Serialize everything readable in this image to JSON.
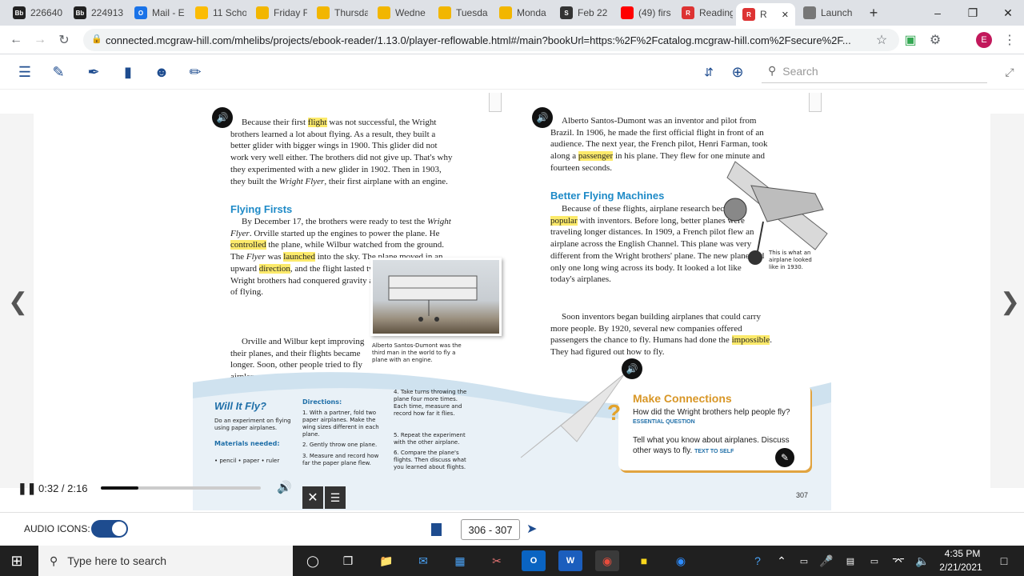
{
  "browser": {
    "tabs": [
      {
        "label": "226640",
        "icon": "Bb",
        "color": "#222"
      },
      {
        "label": "224913",
        "icon": "Bb",
        "color": "#222"
      },
      {
        "label": "Mail - E",
        "icon": "O",
        "color": "#1a73e8"
      },
      {
        "label": "11 Scho",
        "icon": "drive",
        "color": "#fbbc04"
      },
      {
        "label": "Friday F",
        "icon": "folder",
        "color": "#f2b600"
      },
      {
        "label": "Thursda",
        "icon": "folder",
        "color": "#f2b600"
      },
      {
        "label": "Wedne",
        "icon": "folder",
        "color": "#f2b600"
      },
      {
        "label": "Tuesda",
        "icon": "folder",
        "color": "#f2b600"
      },
      {
        "label": "Monda",
        "icon": "folder",
        "color": "#f2b600"
      },
      {
        "label": "Feb 22",
        "icon": "S",
        "color": "#333"
      },
      {
        "label": "(49) firs",
        "icon": "yt",
        "color": "#f00"
      },
      {
        "label": "Reading",
        "icon": "R",
        "color": "#d33"
      },
      {
        "label": "R",
        "icon": "R",
        "color": "#d33"
      },
      {
        "label": "Launch",
        "icon": "globe",
        "color": "#777"
      }
    ],
    "new_tab": "+",
    "url": "connected.mcgraw-hill.com/mhelibs/projects/ebook-reader/1.13.0/player-reflowable.html#/main?bookUrl=https:%2F%2Fcatalog.mcgraw-hill.com%2Fsecure%2F...",
    "profile_initial": "E"
  },
  "reader": {
    "search_placeholder": "Search"
  },
  "page": {
    "left": {
      "p1_a": "Because their first ",
      "p1_hl": "flight",
      "p1_b": " was not successful, the Wright brothers learned a lot about flying. As a result, they built a better glider with bigger wings in 1900. This glider did not work very well either. The brothers did not give up. That's why they experimented with a new glider in 1902. Then in 1903, they built the ",
      "p1_i": "Wright Flyer",
      "p1_c": ", their first airplane with an engine.",
      "heading": "Flying Firsts",
      "p2_a": "By December 17, the brothers were ready to test the ",
      "p2_i1": "Wright Flyer",
      "p2_b": ". Orville started up the engines to power the plane. He ",
      "p2_hl1": "controlled",
      "p2_c": " the plane, while Wilbur watched from the ground. The ",
      "p2_i2": "Flyer",
      "p2_d": " was ",
      "p2_hl2": "launched",
      "p2_e": " into the sky. The plane moved in an upward ",
      "p2_hl3": "direction",
      "p2_f": ", and the flight lasted twelve seconds. The Wright brothers had conquered gravity and unlocked the secrets of flying.",
      "p3": "Orville and Wilbur kept improving their planes, and their flights became longer. Soon, other people tried to fly airplanes.",
      "photo_caption": "Alberto Santos-Dumont was the third man in the world to fly a plane with an engine.",
      "activity_title": "Will It Fly?",
      "activity_intro": "Do an experiment on flying using paper airplanes.",
      "materials_head": "Materials needed:",
      "materials": "• pencil   • paper   • ruler",
      "directions_head": "Directions:",
      "step1": "1. With a partner, fold two paper airplanes. Make the wing sizes different in each plane.",
      "step2": "2. Gently throw one plane.",
      "step3": "3. Measure and record how far the paper plane flew.",
      "step4": "4. Take turns throwing the plane four more times. Each time, measure and record how far it flies.",
      "step5": "5. Repeat the experiment with the other airplane.",
      "step6": "6. Compare the plane's flights. Then discuss what you learned about flights."
    },
    "right": {
      "p1_a": "Alberto Santos-Dumont was an inventor and pilot from Brazil. In 1906, he made the first official flight in front of an audience. The next year, the French pilot, Henri Farman, took along a ",
      "p1_hl": "passenger",
      "p1_b": " in his plane. They flew for one minute and fourteen seconds.",
      "heading": "Better Flying Machines",
      "p2_a": "Because of these flights, airplane research became ",
      "p2_hl": "popular",
      "p2_b": " with inventors. Before long, better planes were traveling longer distances. In 1909, a French pilot flew an airplane across the English Channel. This plane was very different from the Wright brothers' plane. The new plane had only one long wing across its body. It looked a lot like today's airplanes.",
      "p3_a": "Soon inventors began building airplanes that could carry more people. By 1920, several new companies offered passengers the chance to fly. Humans had done the ",
      "p3_hl": "impossible",
      "p3_b": ". They had figured out how to fly.",
      "plane_caption": "This is what an airplane looked like in 1930.",
      "mc_title": "Make Connections",
      "mc_q1": "How did the Wright brothers help people fly?",
      "mc_q1_tag": "ESSENTIAL QUESTION",
      "mc_q2": "Tell what you know about airplanes. Discuss other ways to fly.",
      "mc_q2_tag": "TEXT TO SELF",
      "page_number": "307"
    }
  },
  "audio": {
    "time": "0:32 / 2:16",
    "progress": 0.235
  },
  "bottom": {
    "audio_icons_label": "AUDIO ICONS:",
    "audio_icons_on": true,
    "page_range": "306 - 307"
  },
  "taskbar": {
    "search_placeholder": "Type here to search",
    "time": "4:35 PM",
    "date": "2/21/2021"
  }
}
